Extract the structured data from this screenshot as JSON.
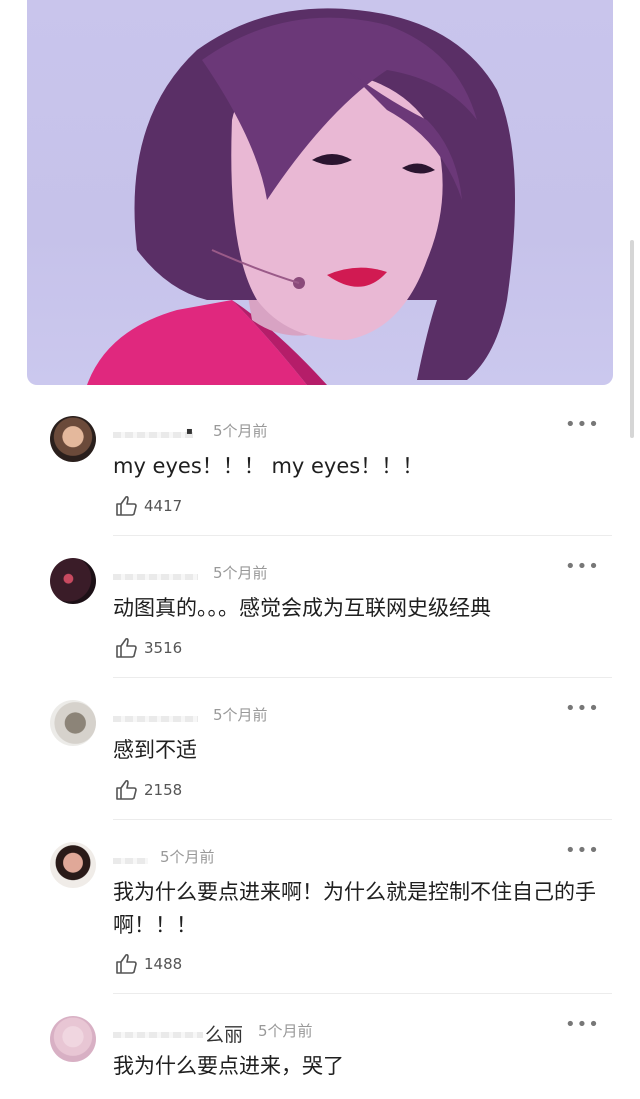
{
  "comments": [
    {
      "time": "5个月前",
      "text": "my eyes！！！ my eyes！！！",
      "likes": "4417",
      "avatar": "avatar-portrait",
      "name_fragment": ""
    },
    {
      "time": "5个月前",
      "text": "动图真的。。。感觉会成为互联网史级经典",
      "likes": "3516",
      "avatar": "avatar-dark-flowers",
      "name_fragment": ""
    },
    {
      "time": "5个月前",
      "text": "感到不适",
      "likes": "2158",
      "avatar": "avatar-object",
      "name_fragment": ""
    },
    {
      "time": "5个月前",
      "text": "我为什么要点进来啊！为什么就是控制不住自己的手啊！！！",
      "likes": "1488",
      "avatar": "avatar-face",
      "name_fragment": ""
    },
    {
      "time": "5个月前",
      "text": "我为什么要点进来，哭了",
      "likes": "",
      "avatar": "avatar-blonde",
      "name_fragment": "么丽"
    }
  ],
  "colors": {
    "photo_bg": "#c8c4ec",
    "shirt": "#e0287e",
    "hair": "#5a2f66"
  }
}
